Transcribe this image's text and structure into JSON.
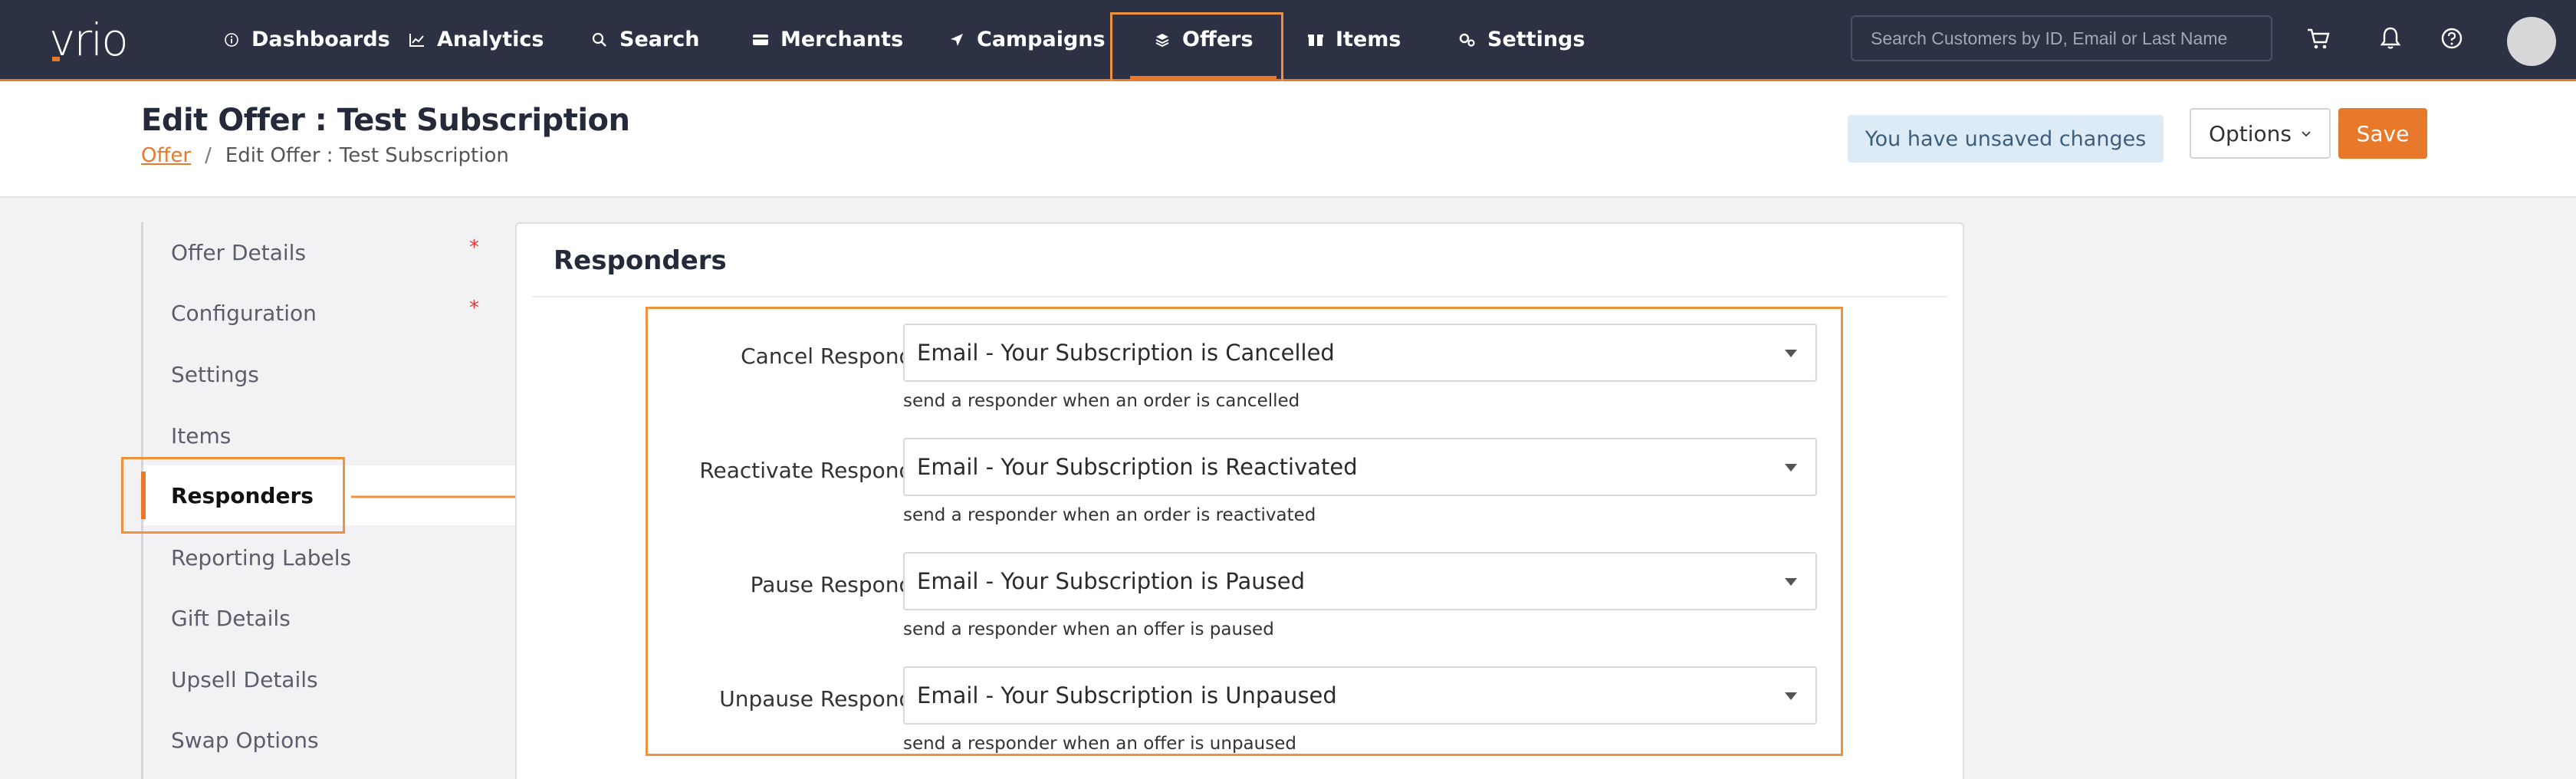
{
  "app": {
    "logo": "vrio",
    "brand_color": "#e8792b",
    "nav_bg": "#2c3244"
  },
  "nav": {
    "items": [
      {
        "label": "Dashboards",
        "icon": "info-circle-icon"
      },
      {
        "label": "Analytics",
        "icon": "line-chart-icon"
      },
      {
        "label": "Search",
        "icon": "search-icon"
      },
      {
        "label": "Merchants",
        "icon": "credit-card-icon"
      },
      {
        "label": "Campaigns",
        "icon": "paper-plane-icon"
      },
      {
        "label": "Offers",
        "icon": "layers-icon",
        "active": true
      },
      {
        "label": "Items",
        "icon": "box-icon"
      },
      {
        "label": "Settings",
        "icon": "gears-icon"
      }
    ],
    "search_placeholder": "Search Customers by ID, Email or Last Name"
  },
  "header": {
    "title": "Edit Offer : Test Subscription",
    "breadcrumb": [
      {
        "label": "Offer",
        "link": true
      },
      {
        "label": "Edit Offer : Test Subscription"
      }
    ],
    "unsaved_notice": "You have unsaved changes",
    "options_label": "Options",
    "save_label": "Save"
  },
  "sidebar": {
    "items": [
      {
        "label": "Offer Details",
        "required": "*"
      },
      {
        "label": "Configuration",
        "required": "*"
      },
      {
        "label": "Settings"
      },
      {
        "label": "Items"
      },
      {
        "label": "Responders",
        "active": true
      },
      {
        "label": "Reporting Labels"
      },
      {
        "label": "Gift Details"
      },
      {
        "label": "Upsell Details"
      },
      {
        "label": "Swap Options"
      }
    ]
  },
  "panel": {
    "title": "Responders",
    "responders": [
      {
        "label": "Cancel Responder:",
        "value": "Email - Your Subscription is Cancelled",
        "help": "send a responder when an order is cancelled"
      },
      {
        "label": "Reactivate Responder:",
        "value": "Email - Your Subscription is Reactivated",
        "help": "send a responder when an order is reactivated"
      },
      {
        "label": "Pause Responder:",
        "value": "Email - Your Subscription is Paused",
        "help": "send a responder when an offer is paused"
      },
      {
        "label": "Unpause Responder:",
        "value": "Email - Your Subscription is Unpaused",
        "help": "send a responder when an offer is unpaused"
      }
    ]
  }
}
